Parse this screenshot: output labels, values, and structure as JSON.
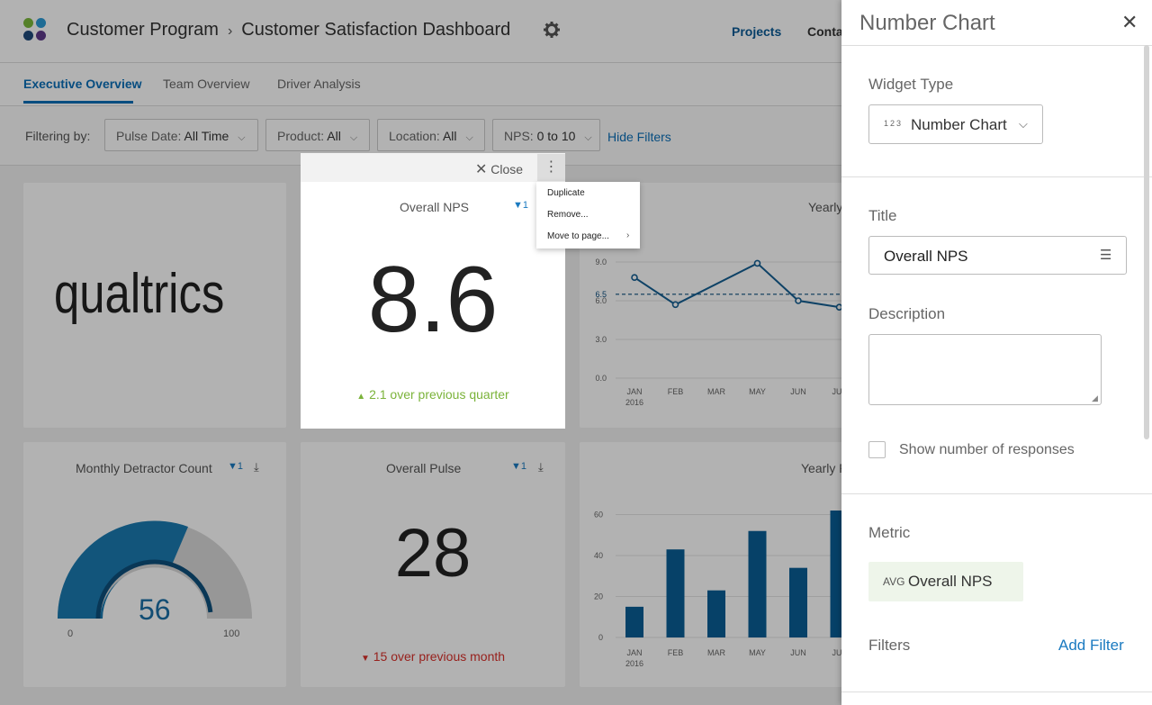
{
  "header": {
    "breadcrumb_root": "Customer Program",
    "breadcrumb_sep": "›",
    "breadcrumb_current": "Customer Satisfaction Dashboard",
    "nav_projects": "Projects",
    "nav_contacts": "Contacts"
  },
  "tabs": [
    "Executive Overview",
    "Team Overview",
    "Driver Analysis"
  ],
  "filters": {
    "label": "Filtering by:",
    "items": [
      {
        "key": "Pulse Date:",
        "value": "All Time"
      },
      {
        "key": "Product:",
        "value": "All"
      },
      {
        "key": "Location:",
        "value": "All"
      },
      {
        "key": "NPS:",
        "value": "0 to 10"
      }
    ],
    "hide_label": "Hide Filters"
  },
  "widgets": {
    "logo_text": "qualtrics",
    "overall_nps": {
      "title": "Overall NPS",
      "filter_count": "1",
      "value": "8.6",
      "change": "2.1 over previous quarter",
      "change_color": "#7bb33a"
    },
    "detractor": {
      "title": "Monthly Detractor Count",
      "filter_count": "1",
      "value": "56",
      "min": "0",
      "max": "100"
    },
    "pulse": {
      "title": "Overall Pulse",
      "filter_count": "1",
      "value": "28",
      "change": "15 over previous month",
      "change_color": "#d9302a"
    },
    "yearly_line_title": "Yearly",
    "yearly_bar_title": "Yearly P"
  },
  "toolbar": {
    "close_label": "Close",
    "kebab": "⋮"
  },
  "context_menu": {
    "items": [
      "Duplicate",
      "Remove...",
      "Move to page..."
    ]
  },
  "panel": {
    "title": "Number Chart",
    "widget_type_label": "Widget Type",
    "widget_type_value": "Number Chart",
    "widget_type_glyph": "123",
    "title_label": "Title",
    "title_value": "Overall NPS",
    "description_label": "Description",
    "description_value": "",
    "show_responses_label": "Show number of responses",
    "metric_label": "Metric",
    "metric_prefix": "AVG",
    "metric_value": "Overall NPS",
    "filters_label": "Filters",
    "add_filter_label": "Add Filter"
  },
  "chart_data": [
    {
      "type": "line",
      "title": "Yearly",
      "x": [
        "JAN 2016",
        "FEB",
        "MAR",
        "MAY",
        "JUN",
        "JUL"
      ],
      "series": [
        {
          "values": [
            7.8,
            5.7,
            null,
            8.9,
            6.0,
            5.5
          ]
        }
      ],
      "reference_line": 6.5,
      "yticks": [
        0.0,
        3.0,
        6.0,
        9.0
      ],
      "ylim": [
        0,
        9
      ]
    },
    {
      "type": "bar",
      "title": "Yearly P",
      "categories": [
        "JAN 2016",
        "FEB",
        "MAR",
        "MAY",
        "JUN",
        "JUL"
      ],
      "values": [
        15,
        43,
        23,
        52,
        34,
        62
      ],
      "yticks": [
        0,
        20,
        40,
        60
      ],
      "ylim": [
        0,
        62
      ]
    }
  ]
}
